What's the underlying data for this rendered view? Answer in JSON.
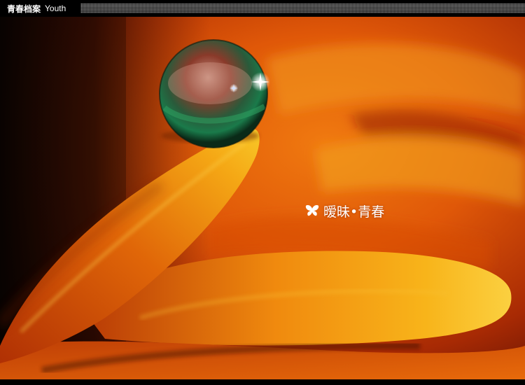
{
  "header": {
    "title_cn": "青春档案",
    "title_en": "Youth"
  },
  "photo": {
    "subject": "water-droplet-on-orange-petal",
    "caption_icon": "butterfly-icon",
    "caption": "暧昧•青春"
  },
  "colors": {
    "background": "#000000",
    "bar_pattern": "#8a8a8a",
    "caption_text": "#ffffff"
  }
}
